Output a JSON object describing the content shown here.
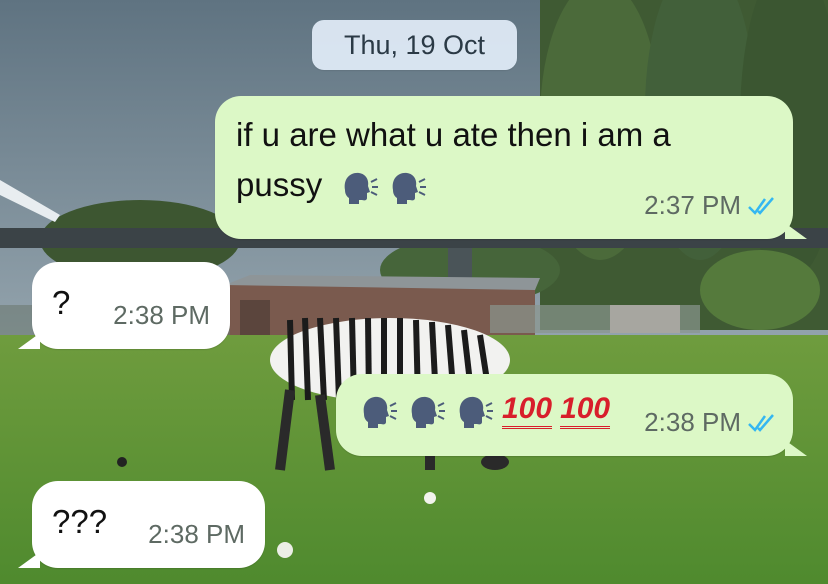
{
  "date_chip": "Thu, 19 Oct",
  "colors": {
    "outgoing_bubble": "#dcf8c6",
    "incoming_bubble": "#ffffff",
    "read_ticks": "#34b7f1",
    "hundred_emoji": "#d81e2b"
  },
  "messages": [
    {
      "direction": "outgoing",
      "text_line1": "if u are what u ate then i am a",
      "text_line2": "pussy",
      "emoji": [
        "speaking-head-icon",
        "speaking-head-icon"
      ],
      "time": "2:37 PM",
      "status": "read"
    },
    {
      "direction": "incoming",
      "text": "?",
      "time": "2:38 PM"
    },
    {
      "direction": "outgoing",
      "emoji": [
        "speaking-head-icon",
        "speaking-head-icon",
        "speaking-head-icon",
        "hundred-points-icon",
        "hundred-points-icon"
      ],
      "hundred_label": "100",
      "time": "2:38 PM",
      "status": "read"
    },
    {
      "direction": "incoming",
      "text": "???",
      "time": "2:38 PM"
    }
  ]
}
